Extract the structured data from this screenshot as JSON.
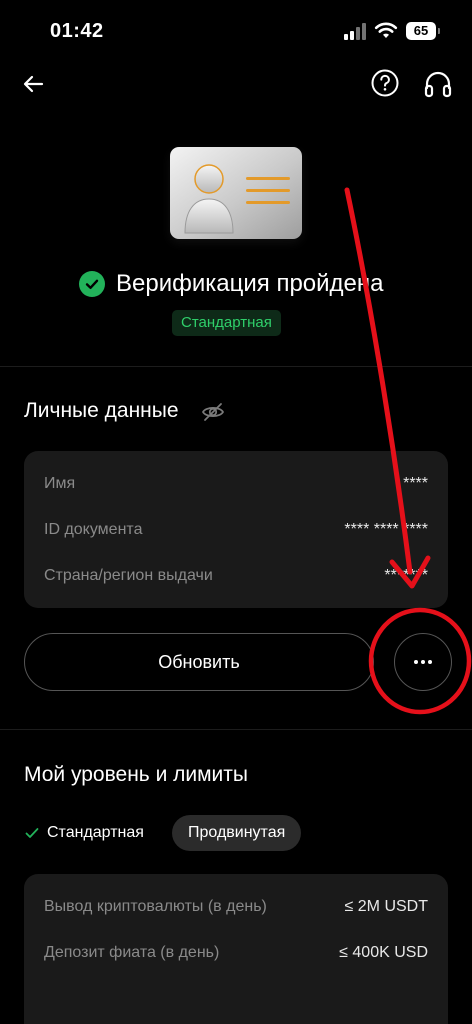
{
  "status_bar": {
    "time": "01:42",
    "battery": "65"
  },
  "verification": {
    "title": "Верификация пройдена",
    "level": "Стандартная"
  },
  "personal_data": {
    "title": "Личные данные",
    "rows": [
      {
        "label": "Имя",
        "value": "****"
      },
      {
        "label": "ID документа",
        "value": "**** **** ****"
      },
      {
        "label": "Страна/регион выдачи",
        "value": "*******"
      }
    ],
    "update_label": "Обновить"
  },
  "limits": {
    "title": "Мой уровень и лимиты",
    "tabs": [
      {
        "label": "Стандартная",
        "selected": true
      },
      {
        "label": "Продвинутая",
        "selected": false
      }
    ],
    "rows": [
      {
        "label": "Вывод криптовалюты (в день)",
        "value": "≤ 2M USDT"
      },
      {
        "label": "Депозит фиата (в день)",
        "value": "≤ 400K USD"
      }
    ]
  },
  "colors": {
    "accent_green": "#22b25a",
    "annotation_red": "#e5101a",
    "card_bg": "#1a1a1a"
  }
}
